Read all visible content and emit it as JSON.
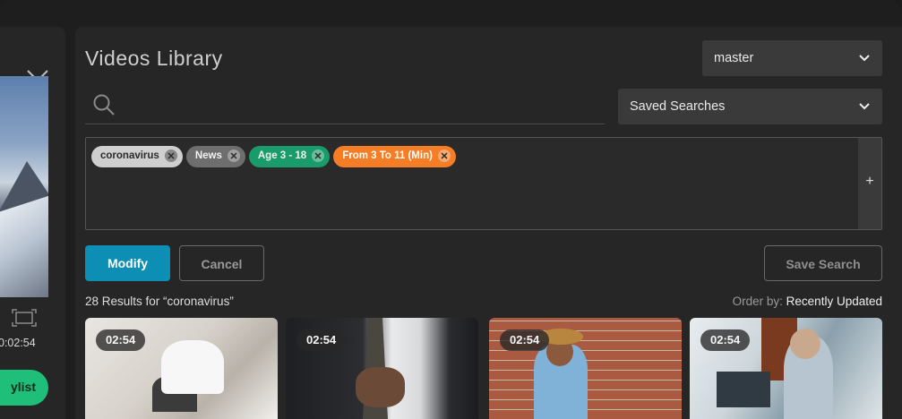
{
  "left_panel": {
    "time": "0:02:54",
    "playlist_button": "ylist"
  },
  "header": {
    "title": "Videos Library",
    "branch_select": "master",
    "saved_searches": "Saved Searches"
  },
  "search": {
    "value": "",
    "placeholder": ""
  },
  "filters": {
    "chips": [
      {
        "label": "coronavirus"
      },
      {
        "label": "News"
      },
      {
        "label": "Age 3 - 18"
      },
      {
        "label": "From 3 To 11 (Min)"
      }
    ],
    "add_label": "+"
  },
  "actions": {
    "modify": "Modify",
    "cancel": "Cancel",
    "save_search": "Save Search"
  },
  "results": {
    "summary": "28 Results for “coronavirus”",
    "order_by_label": "Order by: ",
    "order_by_value": "Recently Updated"
  },
  "videos": [
    {
      "duration": "02:54"
    },
    {
      "duration": "02:54"
    },
    {
      "duration": "02:54"
    },
    {
      "duration": "02:54"
    }
  ],
  "colors": {
    "accent_blue": "#0d8fb5",
    "green": "#1fbf7a",
    "chip_green": "#1a9b6b",
    "chip_orange": "#f47d25"
  }
}
